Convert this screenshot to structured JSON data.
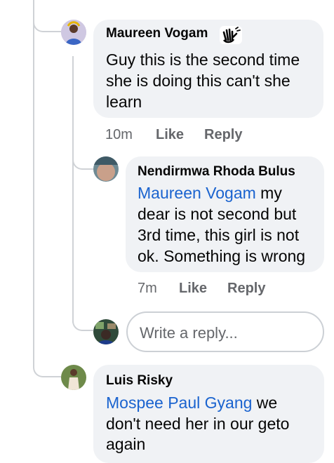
{
  "comments": [
    {
      "author": "Maureen Vogam",
      "badge_icon": "wave-hands-icon",
      "text_lines": [
        "Guy this is the second time",
        "she is doing this can't she",
        "learn"
      ],
      "time": "10m",
      "like_label": "Like",
      "reply_label": "Reply"
    },
    {
      "author": "Nendirmwa Rhoda Bulus",
      "mention": "Maureen Vogam",
      "text_lines": [
        "my",
        "dear is not second but",
        "3rd time, this girl is not",
        "ok. Something is wrong"
      ],
      "time": "7m",
      "like_label": "Like",
      "reply_label": "Reply"
    },
    {
      "author": "Luis Risky",
      "mention": "Mospee Paul Gyang",
      "text_lines": [
        "we",
        "don't need her in our geto",
        "again"
      ]
    }
  ],
  "reply_box": {
    "placeholder": "Write a reply..."
  },
  "colors": {
    "bubble": "#f0f2f5",
    "mention": "#1a63cf",
    "meta": "#65676b",
    "thread_line": "#cfd2d6"
  }
}
